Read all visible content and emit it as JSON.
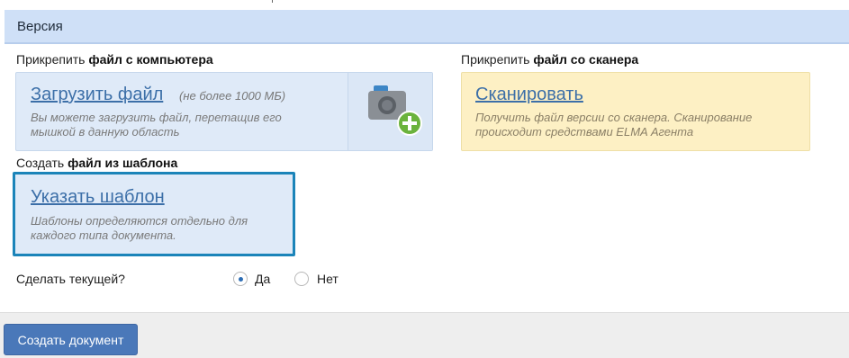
{
  "section": {
    "title": "Версия"
  },
  "upload": {
    "label_prefix": "Прикрепить ",
    "label_bold": "файл с компьютера",
    "link": "Загрузить файл",
    "hint": "(не более 1000 МБ)",
    "desc_line1": "Вы можете загрузить файл, перетащив его",
    "desc_line2": "мышкой в данную область",
    "icon": "camera-add-icon"
  },
  "scan": {
    "label_prefix": "Прикрепить ",
    "label_bold": "файл со сканера",
    "link": "Сканировать",
    "desc_line1": "Получить файл версии со сканера. Сканирование",
    "desc_line2": "происходит средствами ELMA Агента"
  },
  "template": {
    "label_prefix": "Создать ",
    "label_bold": "файл из шаблона",
    "link": "Указать шаблон",
    "desc_line1": "Шаблоны определяются отдельно для",
    "desc_line2": "каждого типа документа."
  },
  "make_current": {
    "question": "Сделать текущей?",
    "options": [
      {
        "label": "Да",
        "selected": true
      },
      {
        "label": "Нет",
        "selected": false
      }
    ]
  },
  "footer": {
    "create_button": "Создать документ"
  },
  "colors": {
    "header_bg": "#cfe0f7",
    "link": "#3c6fa8",
    "scan_bg": "#fdf0c4",
    "template_border": "#1b84b9",
    "button": "#4a78b9"
  }
}
